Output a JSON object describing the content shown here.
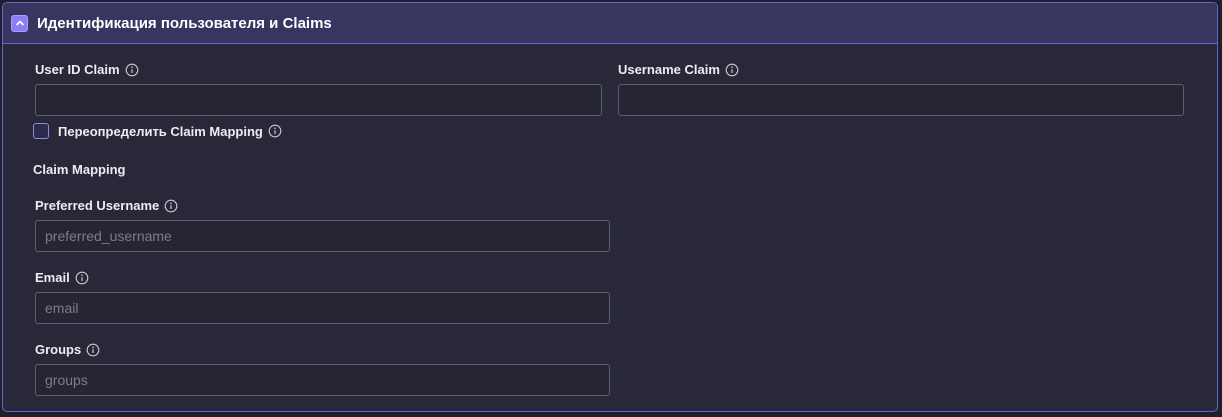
{
  "section": {
    "title": "Идентификация пользователя и Claims"
  },
  "fields": {
    "user_id_claim": {
      "label": "User ID Claim",
      "value": "",
      "placeholder": ""
    },
    "username_claim": {
      "label": "Username Claim",
      "value": "",
      "placeholder": ""
    },
    "override_mapping": {
      "label": "Переопределить Claim Mapping",
      "checked": false
    },
    "claim_mapping_heading": "Claim Mapping",
    "preferred_username": {
      "label": "Preferred Username",
      "value": "",
      "placeholder": "preferred_username"
    },
    "email": {
      "label": "Email",
      "value": "",
      "placeholder": "email"
    },
    "groups": {
      "label": "Groups",
      "value": "",
      "placeholder": "groups"
    }
  },
  "icons": {
    "collapse": "chevron-up-icon",
    "info": "info-circle-icon"
  },
  "colors": {
    "accent": "#8a7df5",
    "border": "#6d62c9",
    "header_bg": "#363660",
    "panel_bg": "#282839"
  }
}
